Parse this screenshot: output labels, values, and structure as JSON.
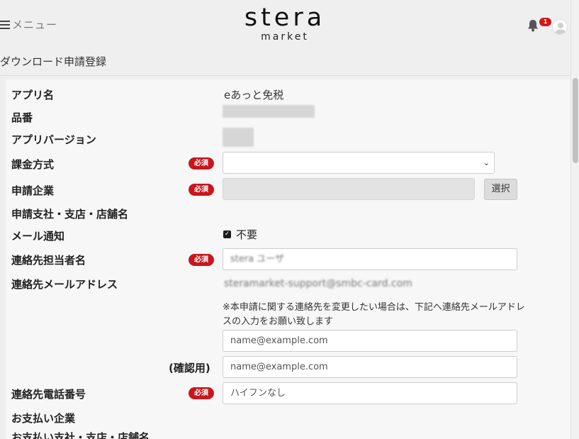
{
  "header": {
    "menu_label": "メニュー",
    "logo_main": "stera",
    "logo_sub": "market",
    "notification_count": "1"
  },
  "page_title": "ダウンロード申請登録",
  "required_badge": "必須",
  "form": {
    "app_name_label": "アプリ名",
    "app_name_value": "eあっと免税",
    "product_no_label": "品番",
    "app_version_label": "アプリバージョン",
    "billing_method_label": "課金方式",
    "billing_method_value": "",
    "applicant_company_label": "申請企業",
    "select_button": "選択",
    "applicant_branch_label": "申請支社・支店・店舗名",
    "mail_notify_label": "メール通知",
    "mail_notify_check": "不要",
    "contact_person_label": "連絡先担当者名",
    "contact_person_value": "stera ユーザ",
    "contact_email_label": "連絡先メールアドレス",
    "contact_email_value": "steramarket-support@smbc-card.com",
    "note": "※本申請に関する連絡先を変更したい場合は、下記へ連絡先メールアドレスの入力をお願い致します",
    "email_placeholder": "name@example.com",
    "email_confirm_label": "(確認用)",
    "email_confirm_placeholder": "name@example.com",
    "phone_label": "連絡先電話番号",
    "phone_placeholder": "ハイフンなし",
    "payment_company_label": "お支払い企業",
    "payment_branch_label": "お支払い支社・支店・店舗名"
  },
  "colors": {
    "required_badge": "#c8161d",
    "background": "#efefef",
    "panel": "#f7f7f7"
  }
}
